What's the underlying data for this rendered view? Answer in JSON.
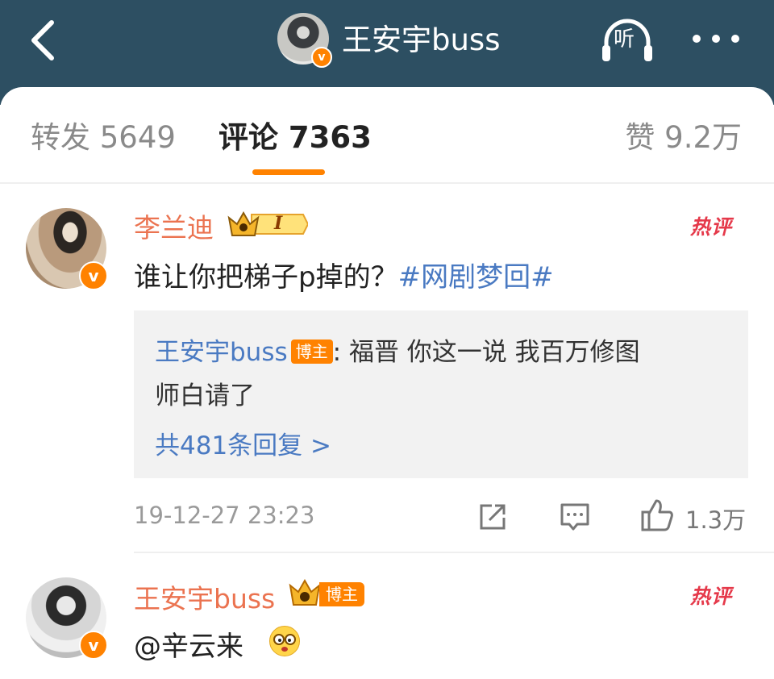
{
  "header": {
    "title": "王安宇buss",
    "listen_label": "听",
    "verified_mark": "v"
  },
  "tabs": {
    "repost": "转发 5649",
    "comment": "评论 7363",
    "like": "赞 9.2万"
  },
  "comments": [
    {
      "username": "李兰迪",
      "badge_text": "I",
      "hot_label": "热评",
      "text": "谁让你把梯子p掉的？",
      "topic": "#网剧梦回#",
      "reply": {
        "user": "王安宇buss",
        "tag": "博主",
        "text_line1": ": 福晋 你这一说 我百万修图",
        "text_line2": "师白请了",
        "more": "共481条回复 >"
      },
      "time": "19-12-27 23:23",
      "likes": "1.3万"
    },
    {
      "username": "王安宇buss",
      "badge_text": "博主",
      "hot_label": "热评",
      "text": "@辛云来"
    }
  ],
  "colors": {
    "topbar": "#2d4f62",
    "accent_orange": "#ff8200",
    "username": "#eb7350",
    "link_blue": "#4a7ac2",
    "hot_red": "#e5394a"
  },
  "icons": [
    "back-icon",
    "headphones-icon",
    "more-dots-icon",
    "crown-icon",
    "share-icon",
    "comment-icon",
    "thumbs-up-icon",
    "emoji-icon",
    "verified-icon"
  ]
}
